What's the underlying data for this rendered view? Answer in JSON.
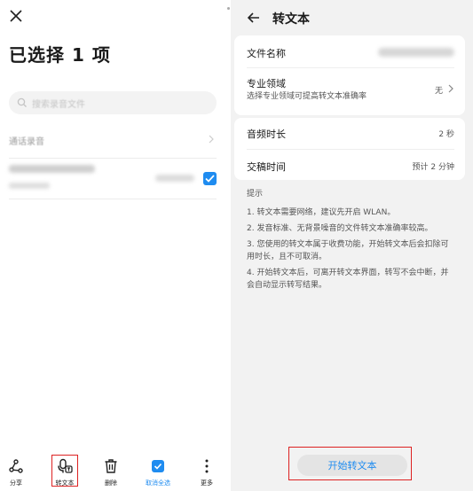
{
  "left": {
    "title": "已选择 1 项",
    "search_placeholder": "搜索录音文件",
    "group_label": "通话录音",
    "toolbar": [
      {
        "label": "分享",
        "icon": "share-icon"
      },
      {
        "label": "转文本",
        "icon": "speech-to-text-icon"
      },
      {
        "label": "删除",
        "icon": "trash-icon"
      },
      {
        "label": "取消全选",
        "icon": "select-all-icon"
      },
      {
        "label": "更多",
        "icon": "more-vertical-icon"
      }
    ]
  },
  "right": {
    "title": "转文本",
    "rows": {
      "filename": {
        "label": "文件名称"
      },
      "domain": {
        "label": "专业领域",
        "sub": "选择专业领域可提高转文本准确率",
        "value": "无"
      },
      "duration": {
        "label": "音频时长",
        "value": "2 秒"
      },
      "delivery": {
        "label": "交稿时间",
        "value": "预计 2 分钟"
      }
    },
    "tips": {
      "heading": "提示",
      "items": [
        "1. 转文本需要网络，建议先开启 WLAN。",
        "2. 发音标准、无背景噪音的文件转文本准确率较高。",
        "3. 您使用的转文本属于收费功能，开始转文本后会扣除可用时长，且不可取消。",
        "4. 开始转文本后，可离开转文本界面，转写不会中断，并会自动显示转写结果。"
      ]
    },
    "start_button": "开始转文本"
  },
  "colors": {
    "accent": "#1f8cf0",
    "highlight": "#dd2222"
  }
}
